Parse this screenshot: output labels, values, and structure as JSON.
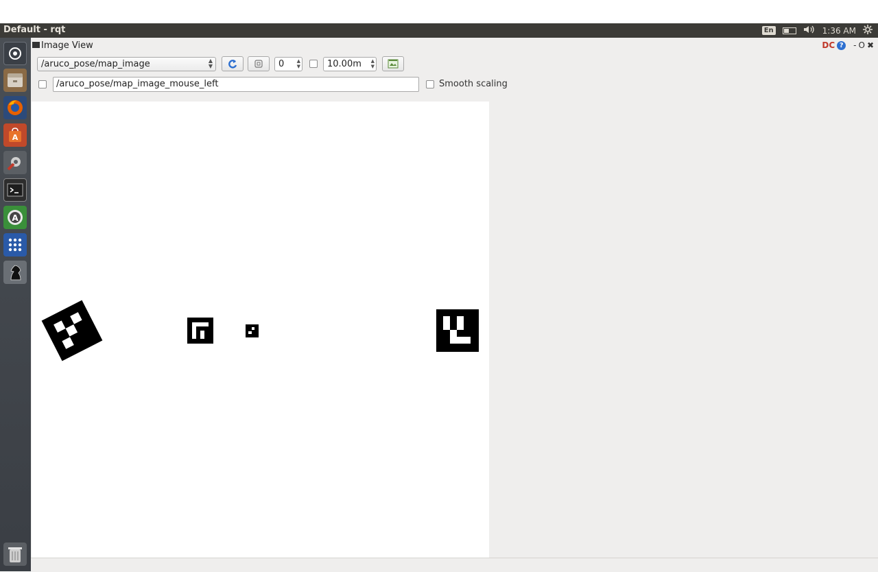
{
  "window": {
    "title": "Default - rqt"
  },
  "tray": {
    "lang": "En",
    "volume_icon": "speaker-icon",
    "time": "1:36 AM",
    "settings_icon": "gear-icon"
  },
  "launcher": {
    "items": [
      {
        "name": "dash-icon",
        "color": "#3a3f46"
      },
      {
        "name": "files-icon",
        "color": "#b07c43"
      },
      {
        "name": "firefox-icon",
        "color": "#e66000"
      },
      {
        "name": "software-center-icon",
        "color": "#e05a1c"
      },
      {
        "name": "system-settings-icon",
        "color": "#6e6e6e"
      },
      {
        "name": "terminal-icon",
        "color": "#2d2d2d"
      },
      {
        "name": "software-updater-icon",
        "color": "#3a8f3a"
      },
      {
        "name": "apps-grid-icon",
        "color": "#2a5aa8"
      },
      {
        "name": "chess-icon",
        "color": "#6a6f75"
      }
    ],
    "trash_icon": "trash-icon"
  },
  "plugin": {
    "title": "Image View",
    "controls": "DC",
    "help": "?",
    "minimize": "-",
    "float": "O",
    "close": "✖"
  },
  "toolbar": {
    "topic": "/aruco_pose/map_image",
    "refresh_icon": "refresh-icon",
    "zoom_icon": "zoom-icon",
    "rotation": "0",
    "max_range": "10.00m",
    "save_icon": "save-image-icon",
    "mouse_topic": "/aruco_pose/map_image_mouse_left",
    "smooth_scaling": "Smooth scaling"
  },
  "colors": {
    "topbar": "#3c3b37",
    "panel": "#efeeed",
    "accent_blue": "#2d6fd0"
  }
}
